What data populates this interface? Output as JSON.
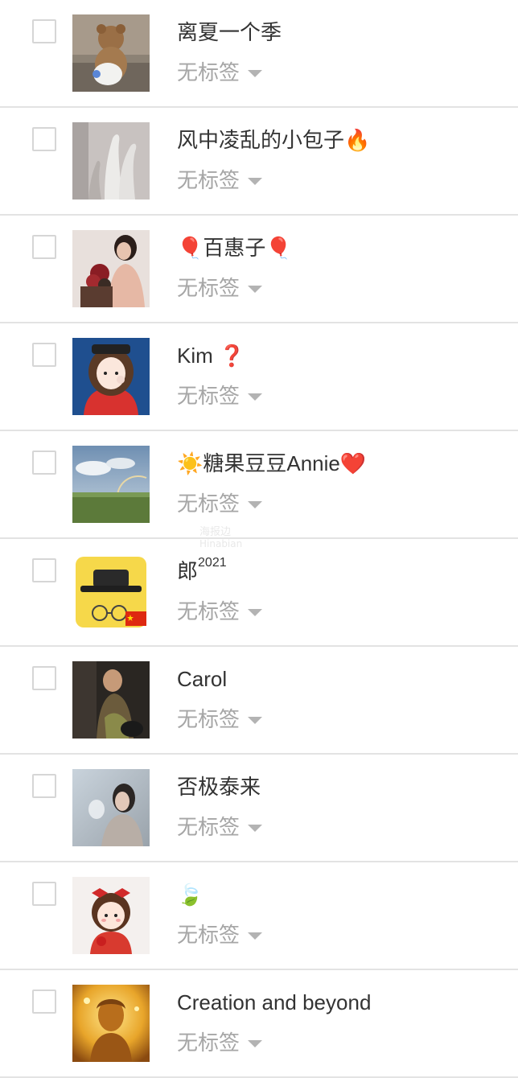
{
  "tag_label": "无标签",
  "watermark": {
    "text": "海报边",
    "sub": "Hinabian"
  },
  "contacts": [
    {
      "name": "离夏一个季",
      "avatar": "teddy-bear-avatar"
    },
    {
      "name": "风中凌乱的小包子🔥",
      "avatar": "geese-figurines-avatar"
    },
    {
      "name": "🎈百惠子🎈",
      "avatar": "woman-with-flowers-avatar"
    },
    {
      "name": "Kim ❓",
      "avatar": "cartoon-girl-avatar"
    },
    {
      "name": "☀️糖果豆豆Annie❤️",
      "avatar": "landscape-rainbow-avatar"
    },
    {
      "name": "郎",
      "sup": "2021",
      "avatar": "hat-glasses-flag-avatar"
    },
    {
      "name": "Carol",
      "avatar": "fashion-photo-avatar"
    },
    {
      "name": "否极泰来",
      "avatar": "woman-portrait-avatar"
    },
    {
      "name": "🍃",
      "avatar": "cartoon-girl-red-bows-avatar"
    },
    {
      "name": "Creation and beyond",
      "avatar": "golden-statue-avatar"
    }
  ]
}
